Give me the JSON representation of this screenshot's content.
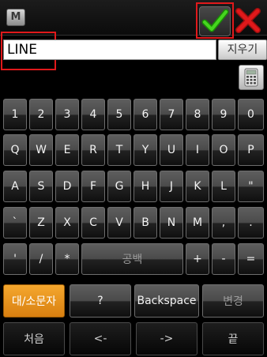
{
  "toolbar": {
    "menu_label": "M",
    "ok_icon": "checkmark-icon",
    "cancel_icon": "close-x-icon"
  },
  "input": {
    "value": "LINE",
    "clear_label": "지우기"
  },
  "calculator": {
    "icon": "calculator-icon"
  },
  "keys": {
    "r1": [
      "1",
      "2",
      "3",
      "4",
      "5",
      "6",
      "7",
      "8",
      "9",
      "0"
    ],
    "r2": [
      "Q",
      "W",
      "E",
      "R",
      "T",
      "Y",
      "U",
      "I",
      "O",
      "P"
    ],
    "r3": [
      "A",
      "S",
      "D",
      "F",
      "G",
      "H",
      "J",
      "K",
      "L",
      "\""
    ],
    "r4": [
      "`",
      "Z",
      "X",
      "C",
      "V",
      "B",
      "N",
      "M",
      ",",
      "."
    ],
    "r5": {
      "apos": "'",
      "slash": "/",
      "star": "*",
      "space": "공백",
      "plus": "+",
      "minus": "-",
      "equals": "="
    },
    "r6": {
      "case": "대/소문자",
      "question": "?",
      "backspace": "Backspace",
      "change": "변경"
    },
    "r7": {
      "first": "처음",
      "left": "<-",
      "right": "->",
      "end": "끝"
    }
  },
  "colors": {
    "accent_orange": "#e8931e",
    "ok_green": "#3fcf1c",
    "cancel_red": "#e0191b",
    "highlight_red": "#e0191b"
  }
}
